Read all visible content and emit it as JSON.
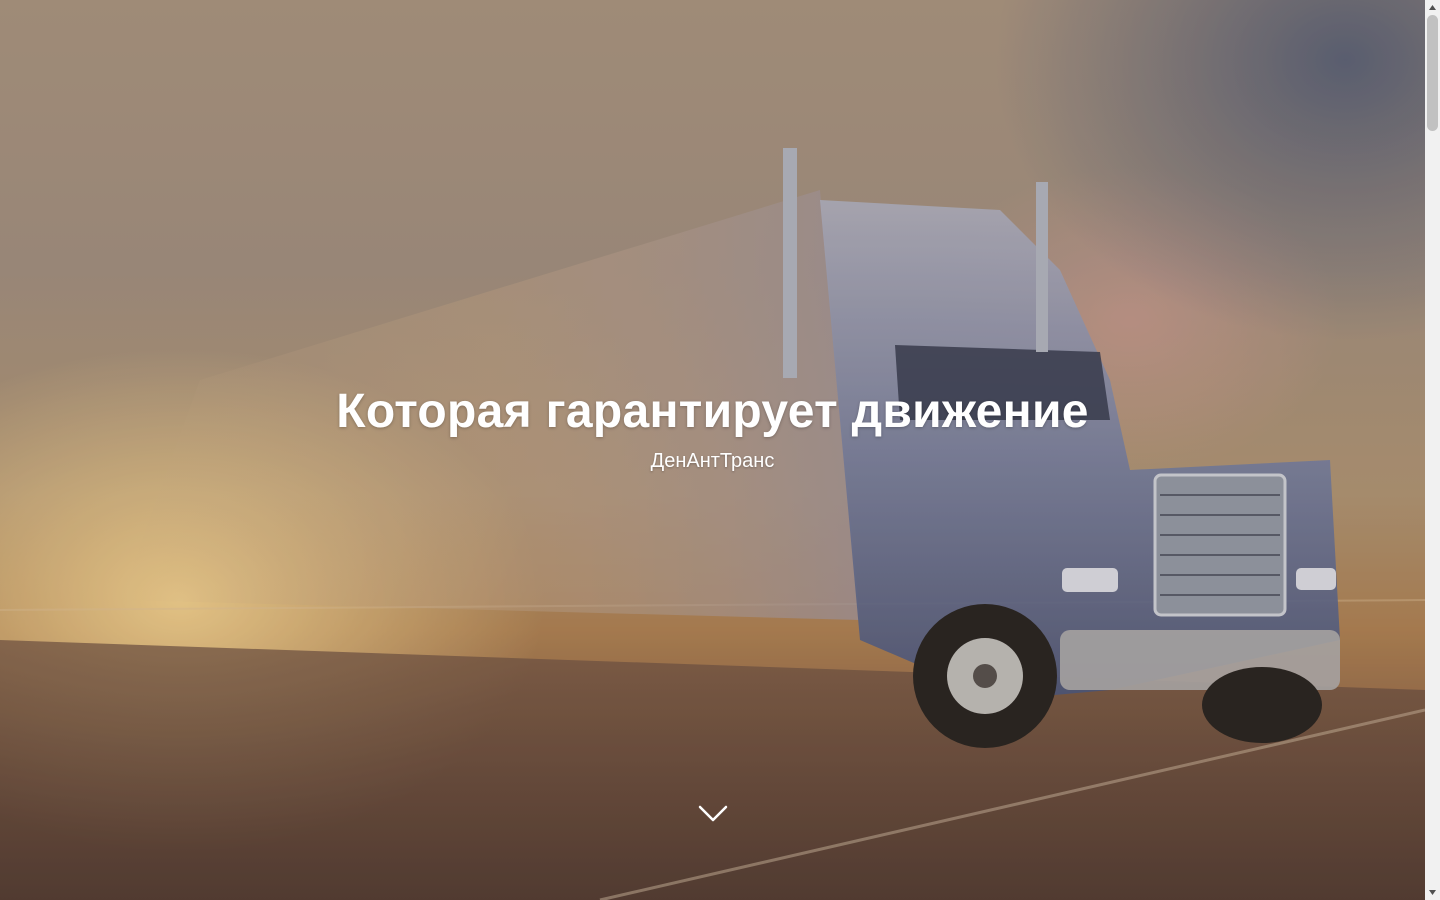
{
  "hero": {
    "title": "Которая гарантирует движение",
    "subtitle": "ДенАнтТранс",
    "background_image": "truck-on-highway-photo",
    "scroll_icon": "chevron-down-icon"
  },
  "colors": {
    "text": "#ffffff",
    "scrollbar_track": "#f1f1f1",
    "scrollbar_thumb": "#c1c1c1"
  }
}
